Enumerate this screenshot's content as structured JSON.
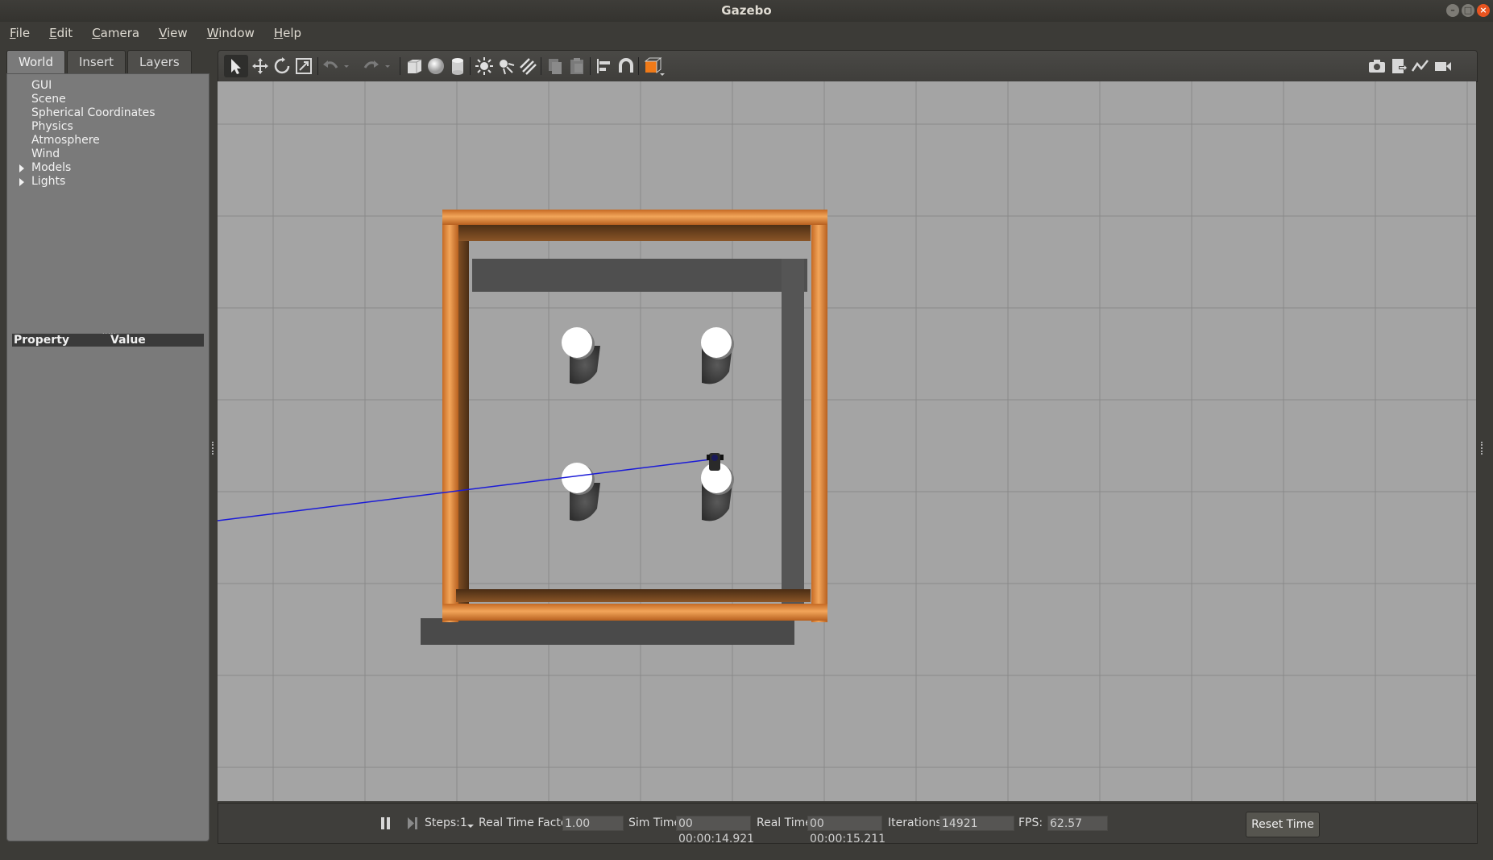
{
  "window": {
    "title": "Gazebo",
    "buttons": {
      "minimize": "–",
      "maximize": "□",
      "close": "×"
    }
  },
  "menubar": {
    "items": [
      {
        "label": "File",
        "mnemonic": "F"
      },
      {
        "label": "Edit",
        "mnemonic": "E"
      },
      {
        "label": "Camera",
        "mnemonic": "C"
      },
      {
        "label": "View",
        "mnemonic": "V"
      },
      {
        "label": "Window",
        "mnemonic": "W"
      },
      {
        "label": "Help",
        "mnemonic": "H"
      }
    ]
  },
  "left_panel": {
    "tabs": [
      {
        "label": "World",
        "active": true
      },
      {
        "label": "Insert",
        "active": false
      },
      {
        "label": "Layers",
        "active": false
      }
    ],
    "tree": [
      {
        "label": "GUI",
        "expandable": false
      },
      {
        "label": "Scene",
        "expandable": false
      },
      {
        "label": "Spherical Coordinates",
        "expandable": false
      },
      {
        "label": "Physics",
        "expandable": false
      },
      {
        "label": "Atmosphere",
        "expandable": false
      },
      {
        "label": "Wind",
        "expandable": false
      },
      {
        "label": "Models",
        "expandable": true
      },
      {
        "label": "Lights",
        "expandable": true
      }
    ],
    "splitter": ".....",
    "property_header": {
      "property": "Property",
      "value": "Value"
    }
  },
  "toolbar": {
    "icons": [
      "select-arrow-icon",
      "translate-icon",
      "rotate-icon",
      "scale-icon",
      "undo-icon",
      "undo-dropdown-icon",
      "redo-icon",
      "redo-dropdown-icon",
      "box-shape-icon",
      "sphere-shape-icon",
      "cylinder-shape-icon",
      "point-light-icon",
      "spot-light-icon",
      "directional-light-icon",
      "copy-icon",
      "paste-icon",
      "align-icon",
      "snap-icon",
      "change-view-icon",
      "screenshot-icon",
      "log-icon",
      "plot-icon",
      "video-record-icon"
    ],
    "colors": {
      "icon": "#d8d8d8",
      "accent_orange": "#f07a18"
    }
  },
  "viewport": {
    "colors": {
      "ground": "#a4a4a4",
      "grid": "#8a8a8a",
      "wall_wood": "#d9863a",
      "wall_inner": "#5a3b1e",
      "shadow": "#4a4a4a",
      "pillar_top": "#ffffff",
      "laser_line": "#1b1bd8"
    }
  },
  "bottombar": {
    "pause_icon": "pause-icon",
    "step_icon": "step-icon",
    "steps_label": "Steps:",
    "steps_value": "1",
    "rtf_label": "Real Time Factor:",
    "rtf_value": "1.00",
    "sim_time_label": "Sim Time:",
    "sim_time_value": "00 00:00:14.921",
    "real_time_label": "Real Time:",
    "real_time_value": "00 00:00:15.211",
    "iterations_label": "Iterations:",
    "iterations_value": "14921",
    "fps_label": "FPS:",
    "fps_value": "62.57",
    "reset_label": "Reset Time"
  }
}
